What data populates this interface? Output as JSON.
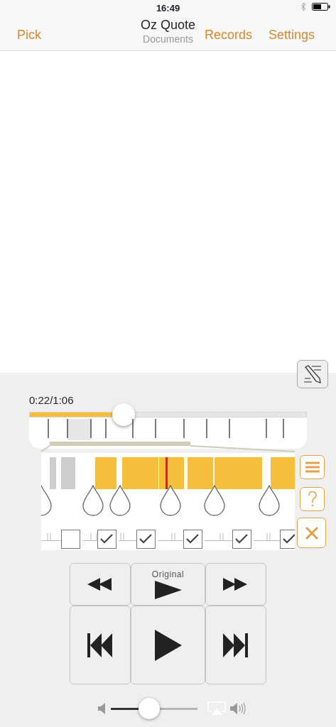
{
  "status_bar": {
    "time": "16:49"
  },
  "nav": {
    "left": "Pick",
    "title": "Oz Quote",
    "subtitle": "Documents",
    "right": [
      "Records",
      "Settings"
    ]
  },
  "player": {
    "position": "0:22/1:06",
    "level": 0.34
  },
  "markers": [
    {
      "checked": false
    },
    {
      "checked": true
    },
    {
      "checked": true
    },
    {
      "checked": true
    },
    {
      "checked": true
    },
    {
      "checked": true
    }
  ],
  "transport": {
    "original_label": "Original"
  },
  "volume": {
    "level": 0.44
  }
}
